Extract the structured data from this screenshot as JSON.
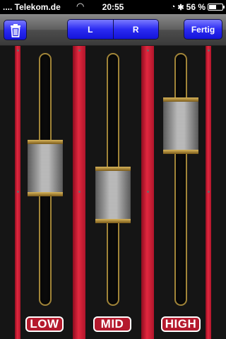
{
  "status_bar": {
    "carrier": ".... Telekom.de",
    "wifi_icon": "wifi-icon",
    "time": "20:55",
    "lock_icon": "rotation-lock-icon",
    "bluetooth_icon": "bluetooth-icon",
    "battery_percent": "56 %",
    "battery_level": 0.56
  },
  "toolbar": {
    "trash_icon": "trash-icon",
    "segments": [
      {
        "label": "L"
      },
      {
        "label": "R"
      }
    ],
    "done_label": "Fertig"
  },
  "colors": {
    "toolbar_button": "#2b2bf2",
    "rail": "#e2283f",
    "label_bg": "#b51a2d",
    "slot_border": "#a08438"
  },
  "faders": [
    {
      "label": "LOW",
      "level": 0.54
    },
    {
      "label": "MID",
      "level": 0.41
    },
    {
      "label": "HIGH",
      "level": 0.75
    }
  ]
}
